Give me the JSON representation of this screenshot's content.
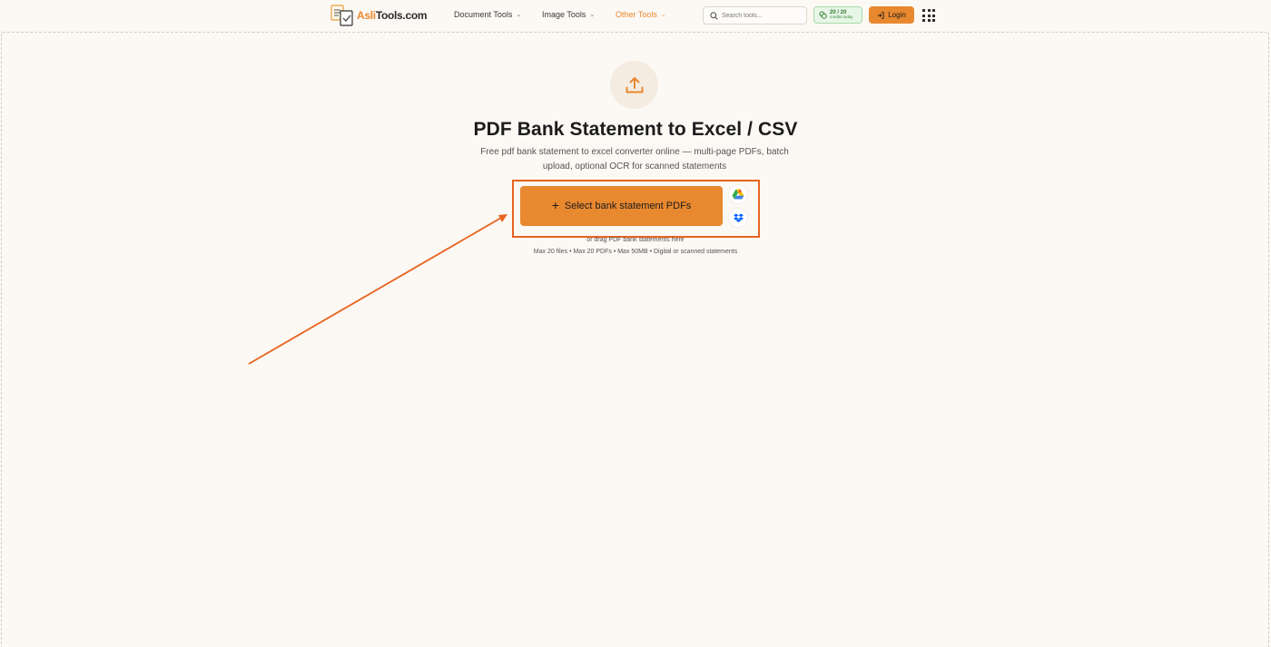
{
  "header": {
    "logo": {
      "brand": "Asli",
      "suffix": "Tools.com"
    },
    "nav": [
      {
        "label": "Document Tools",
        "active": false
      },
      {
        "label": "Image Tools",
        "active": false
      },
      {
        "label": "Other Tools",
        "active": true
      }
    ],
    "search": {
      "placeholder": "Search tools...",
      "icon": "search-icon"
    },
    "credits": {
      "count": "20 / 20",
      "sub": "credits today",
      "icon": "coins-icon"
    },
    "login": {
      "label": "Login",
      "icon": "login-icon"
    },
    "apps_icon": "grid-icon"
  },
  "main": {
    "upload_icon": "upload-icon",
    "title": "PDF Bank Statement to Excel / CSV",
    "subtitle": "Free pdf bank statement to excel converter online — multi-page PDFs, batch upload, optional OCR for scanned statements",
    "select_button": {
      "plus": "+",
      "label": "Select bank statement PDFs"
    },
    "cloud_sources": [
      {
        "name": "google-drive",
        "icon": "google-drive-icon"
      },
      {
        "name": "dropbox",
        "icon": "dropbox-icon"
      }
    ],
    "drag_hint": "or drag PDF bank statements here",
    "limits": "Max 20 files • Max 20 PDFs • Max 50MB • Digital or scanned statements"
  },
  "colors": {
    "accent": "#e8882f",
    "annotation": "#e8641f",
    "background": "#fcf8f4",
    "credits_green": "#2f7a2f"
  }
}
